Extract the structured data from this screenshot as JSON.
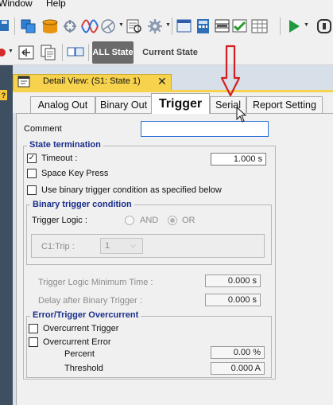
{
  "menu": {
    "window": "Window",
    "help": "Help"
  },
  "toolbar": {
    "all_state": "ALL State",
    "current_state": "Current State"
  },
  "detail_view": {
    "title": "Detail View: (S1: State 1)",
    "close": "✕"
  },
  "tabs": [
    "Analog Out",
    "Binary Out",
    "Trigger",
    "Serial",
    "Report Setting"
  ],
  "comment": {
    "label": "Comment",
    "value": ""
  },
  "state_termination": {
    "title": "State termination",
    "timeout_label": "Timeout :",
    "timeout_checked": true,
    "timeout_value": "1.000 s",
    "space_key_label": "Space Key Press",
    "space_key_checked": false,
    "binary_trigger_label": "Use binary trigger condition as specified below",
    "binary_trigger_checked": false
  },
  "binary_trigger": {
    "title": "Binary trigger condition",
    "logic_label": "Trigger Logic :",
    "and_label": "AND",
    "or_label": "OR",
    "selected": "OR",
    "channel_label": "C1:Trip :",
    "channel_value": "1"
  },
  "timing": {
    "min_time_label": "Trigger Logic Minimum Time :",
    "min_time_value": "0.000 s",
    "delay_label": "Delay after Binary Trigger :",
    "delay_value": "0.000 s"
  },
  "overcurrent": {
    "title": "Error/Trigger Overcurrent",
    "trigger_label": "Overcurrent Trigger",
    "error_label": "Overcurrent Error",
    "percent_label": "Percent",
    "percent_value": "0.00 %",
    "threshold_label": "Threshold",
    "threshold_value": "0.000 A"
  },
  "colors": {
    "accent_tab": "#f6d24d",
    "group_title": "#1a2e8c",
    "annotation_arrow": "#d41f1f",
    "all_state_bg": "#6a6a6a"
  }
}
